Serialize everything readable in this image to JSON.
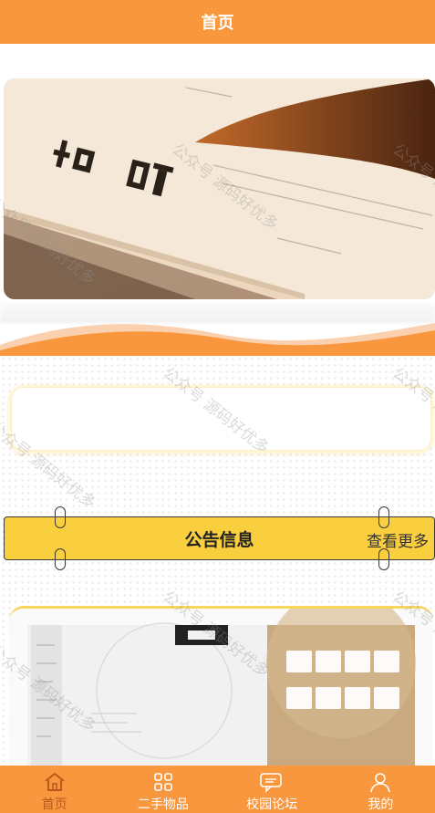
{
  "header": {
    "title": "首页"
  },
  "watermark": {
    "text": "公众号 源码好优多"
  },
  "notice": {
    "title": "公告信息",
    "more": "查看更多"
  },
  "tabs": [
    {
      "label": "首页",
      "icon": "home-icon",
      "active": true
    },
    {
      "label": "二手物品",
      "icon": "grid-icon",
      "active": false
    },
    {
      "label": "校园论坛",
      "icon": "chat-icon",
      "active": false
    },
    {
      "label": "我的",
      "icon": "user-icon",
      "active": false
    }
  ],
  "colors": {
    "primary": "#f9973e",
    "notice": "#f9cf3f",
    "active_tab": "#b7591b"
  }
}
